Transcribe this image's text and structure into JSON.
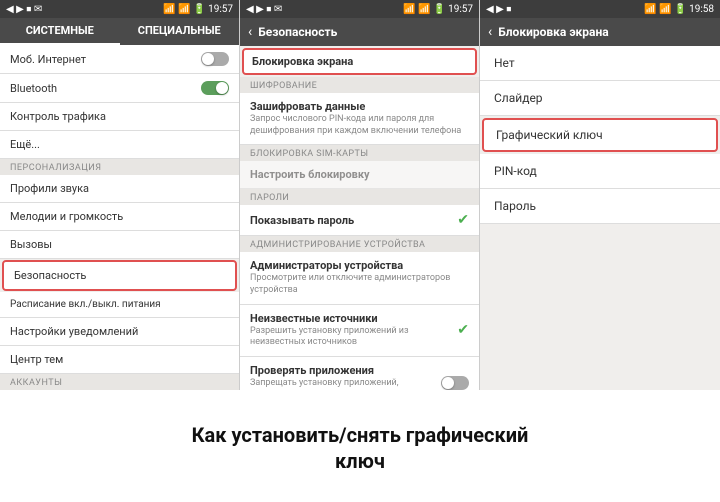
{
  "screen1": {
    "status_bar": {
      "left_icons": "◀ ▶ ⏹ ✉",
      "right_icons": "📶 📶 🔋 19:57"
    },
    "tabs": [
      {
        "label": "СИСТЕМНЫЕ",
        "active": true
      },
      {
        "label": "СПЕЦИАЛЬНЫЕ",
        "active": false
      }
    ],
    "items": [
      {
        "text": "Моб. Интернет",
        "type": "toggle",
        "on": false,
        "section": null
      },
      {
        "text": "Bluetooth",
        "type": "toggle",
        "on": true,
        "section": null
      },
      {
        "text": "Контроль трафика",
        "type": "plain",
        "section": null
      },
      {
        "text": "Ещё...",
        "type": "plain",
        "section": null
      },
      {
        "text": "Профили звука",
        "type": "plain",
        "section": "ПЕРСОНАЛИЗАЦИЯ"
      },
      {
        "text": "Мелодии и громкость",
        "type": "plain",
        "section": null
      },
      {
        "text": "Вызовы",
        "type": "plain",
        "section": null
      },
      {
        "text": "Безопасность",
        "type": "plain",
        "highlighted": true,
        "section": null
      },
      {
        "text": "Расписание вкл./выкл. питания",
        "type": "plain",
        "section": null
      },
      {
        "text": "Настройки уведомлений",
        "type": "plain",
        "section": null
      },
      {
        "text": "Центр тем",
        "type": "plain",
        "section": null
      },
      {
        "text": "АККАУНТЫ",
        "type": "plain",
        "section": null
      }
    ]
  },
  "screen2": {
    "status_bar": {
      "left_icons": "◀ ▶ ⏹ ✉",
      "right_icons": "📶 📶 🔋 19:57"
    },
    "title": "Безопасность",
    "sections": [
      {
        "label": "",
        "items": [
          {
            "title": "Блокировка экрана",
            "subtitle": "",
            "type": "plain",
            "highlighted": true
          }
        ]
      },
      {
        "label": "ШИФРОВАНИЕ",
        "items": [
          {
            "title": "Зашифровать данные",
            "subtitle": "Запрос числового PIN-кода или пароля для дешифрования при каждом включении телефона",
            "type": "plain"
          }
        ]
      },
      {
        "label": "БЛОКИРОВКА SIM-КАРТЫ",
        "items": [
          {
            "title": "Настроить блокировку",
            "subtitle": "",
            "type": "plain",
            "disabled": true
          }
        ]
      },
      {
        "label": "ПАРОЛИ",
        "items": [
          {
            "title": "Показывать пароль",
            "subtitle": "",
            "type": "toggle",
            "on": true
          }
        ]
      },
      {
        "label": "АДМИНИСТРИРОВАНИЕ УСТРОЙСТВА",
        "items": [
          {
            "title": "Администраторы устройства",
            "subtitle": "Просмотрите или отключите администраторов устройства",
            "type": "plain"
          },
          {
            "title": "Неизвестные источники",
            "subtitle": "Разрешить установку приложений из неизвестных источников",
            "type": "toggle",
            "on": true
          },
          {
            "title": "Проверять приложения",
            "subtitle": "Запрещать установку приложений, которые...",
            "type": "toggle",
            "on": false
          }
        ]
      }
    ]
  },
  "screen3": {
    "status_bar": {
      "left_icons": "◀ ▶ ⏹",
      "right_icons": "📶 📶 🔋 19:58"
    },
    "title": "Блокировка экрана",
    "options": [
      {
        "text": "Нет",
        "highlighted": false
      },
      {
        "text": "Слайдер",
        "highlighted": false
      },
      {
        "text": "Графический ключ",
        "highlighted": true
      },
      {
        "text": "PIN-код",
        "highlighted": false
      },
      {
        "text": "Пароль",
        "highlighted": false
      }
    ]
  },
  "caption": {
    "line1": "Как установить/снять графический",
    "line2": "ключ"
  }
}
